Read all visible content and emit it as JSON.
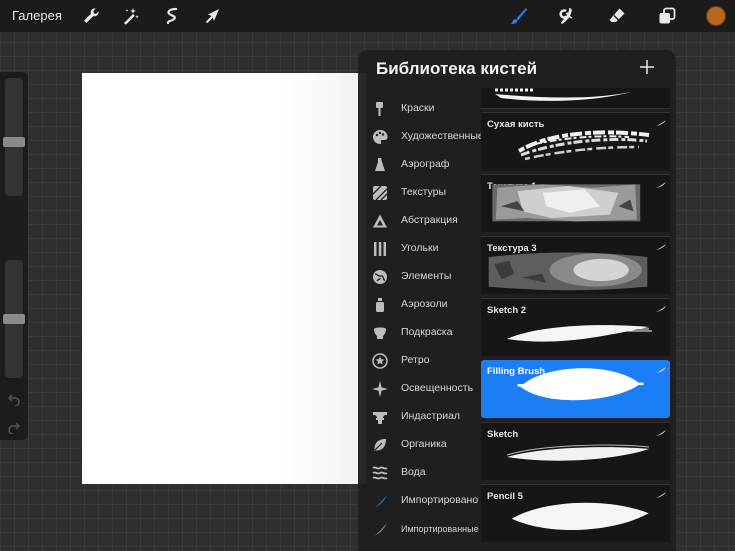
{
  "topbar": {
    "gallery_label": "Галерея",
    "tools": [
      "wrench-icon",
      "magic-wand-icon",
      "selection-icon",
      "transform-arrow-icon"
    ],
    "right_tools": [
      "brush-icon",
      "smudge-icon",
      "eraser-icon",
      "layers-icon"
    ],
    "active_tool": "brush-icon",
    "accent_color": "#2b7cf6",
    "current_color": "#b8671c"
  },
  "sidebar": {
    "size_slider_value": 0.45,
    "opacity_slider_value": 0.5
  },
  "library": {
    "title": "Библиотека кистей",
    "add_icon": "plus-icon",
    "sets": [
      {
        "label": "Краски",
        "icon": "paint-brush-icon"
      },
      {
        "label": "Художественные",
        "icon": "palette-icon"
      },
      {
        "label": "Аэрограф",
        "icon": "airbrush-icon"
      },
      {
        "label": "Текстуры",
        "icon": "texture-icon"
      },
      {
        "label": "Абстракция",
        "icon": "triangle-icon"
      },
      {
        "label": "Угольки",
        "icon": "charcoal-icon"
      },
      {
        "label": "Элементы",
        "icon": "globe-icon"
      },
      {
        "label": "Аэрозоли",
        "icon": "spray-can-icon"
      },
      {
        "label": "Подкраска",
        "icon": "sponge-icon"
      },
      {
        "label": "Ретро",
        "icon": "star-badge-icon"
      },
      {
        "label": "Освещенность",
        "icon": "sparkle-icon"
      },
      {
        "label": "Индастриал",
        "icon": "anvil-icon"
      },
      {
        "label": "Органика",
        "icon": "leaf-icon"
      },
      {
        "label": "Вода",
        "icon": "waves-icon"
      },
      {
        "label": "Импортировано",
        "icon": "imported-stroke-icon",
        "highlighted": true
      },
      {
        "label": "Импортированные",
        "icon": "imported-stroke-icon"
      }
    ],
    "brushes": [
      {
        "name": "Сухая кисть",
        "style": "dry"
      },
      {
        "name": "Текстура 1",
        "style": "texture"
      },
      {
        "name": "Текстура 3",
        "style": "texture-round"
      },
      {
        "name": "Sketch 2",
        "style": "smooth"
      },
      {
        "name": "Filling Brush",
        "style": "filling",
        "selected": true
      },
      {
        "name": "Sketch",
        "style": "sketch"
      },
      {
        "name": "Pencil 5",
        "style": "pencil"
      }
    ]
  }
}
